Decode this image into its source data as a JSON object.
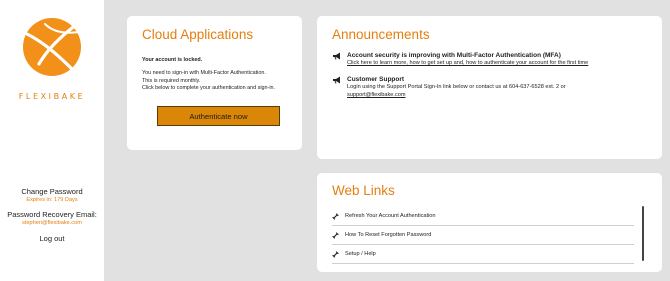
{
  "sidebar": {
    "logo_text": "FLEXIBAKE",
    "change_password": "Change Password",
    "expires": "Expires in: 179 Days",
    "recovery_label": "Password Recovery Email:",
    "recovery_email": "stephen@flexibake.com",
    "logout": "Log out"
  },
  "cloud": {
    "title": "Cloud Applications",
    "locked": "Your account is locked.",
    "msg_line1": "You need to sign-in with Multi-Factor Authentication.",
    "msg_line2": "This is required monthly.",
    "msg_line3": "Click below to complete your authentication and sign-in.",
    "button": "Authenticate now"
  },
  "announcements": {
    "title": "Announcements",
    "items": [
      {
        "icon": "megaphone-icon",
        "title": "Account security is improving with Multi-Factor Authentication (MFA)",
        "link": "Click here to learn more, how to get set up and, how to authenticate your account for the first time"
      },
      {
        "icon": "megaphone-icon",
        "title": "Customer Support",
        "body": "Login using the Support Portal Sign-In link below or contact us at 604-637-6528 ext. 2 or",
        "link": "support@flexibake.com"
      }
    ]
  },
  "weblinks": {
    "title": "Web Links",
    "items": [
      {
        "icon": "link-icon",
        "label": "Refresh Your Account Authentication"
      },
      {
        "icon": "link-icon",
        "label": "How To Reset Forgotten Password"
      },
      {
        "icon": "link-icon",
        "label": "Setup / Help"
      }
    ]
  },
  "colors": {
    "accent": "#e47f10",
    "logo": "#f39019",
    "button": "#da8606",
    "background": "#e1e1e1"
  }
}
